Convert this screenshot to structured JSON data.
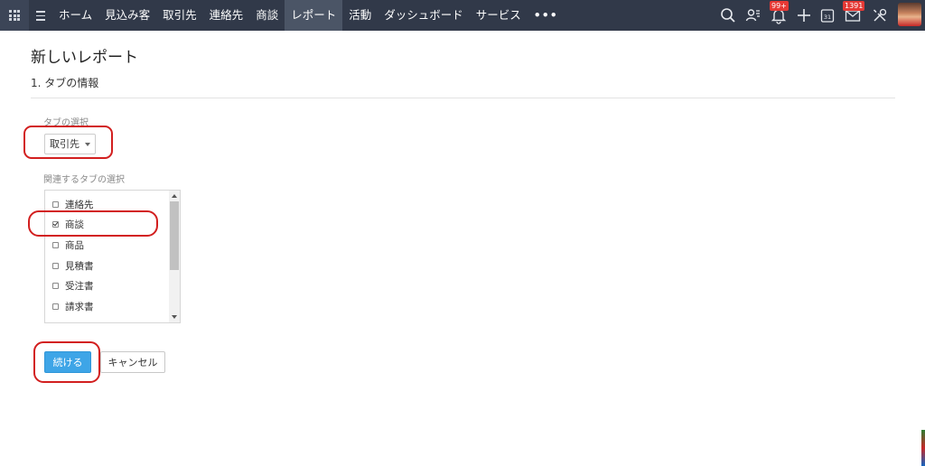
{
  "topnav": {
    "items": [
      "ホーム",
      "見込み客",
      "取引先",
      "連絡先",
      "商談",
      "レポート",
      "活動",
      "ダッシュボード",
      "サービス"
    ],
    "active": "レポート",
    "more": "•••",
    "notification_badge": "99+",
    "mail_badge": "1391",
    "icons": [
      "apps-grid-icon",
      "hamburger-icon",
      "search-icon",
      "contacts-icon",
      "bell-icon",
      "plus-icon",
      "calendar-icon",
      "mail-icon",
      "tools-icon",
      "avatar"
    ],
    "calendar_day": "31"
  },
  "page": {
    "title": "新しいレポート",
    "section": "1.  タブの情報"
  },
  "form": {
    "tab_select_label": "タブの選択",
    "tab_select_value": "取引先",
    "related_label": "関連するタブの選択",
    "related_tabs": [
      {
        "label": "連絡先",
        "checked": false
      },
      {
        "label": "商談",
        "checked": true
      },
      {
        "label": "商品",
        "checked": false
      },
      {
        "label": "見積書",
        "checked": false
      },
      {
        "label": "受注書",
        "checked": false
      },
      {
        "label": "請求書",
        "checked": false
      }
    ]
  },
  "buttons": {
    "continue": "続ける",
    "cancel": "キャンセル"
  },
  "colors": {
    "topbar": "#313949",
    "active_tab": "#4b5566",
    "primary_button": "#3ea5e7",
    "annotation": "#d21f1f",
    "badge": "#e53935"
  }
}
